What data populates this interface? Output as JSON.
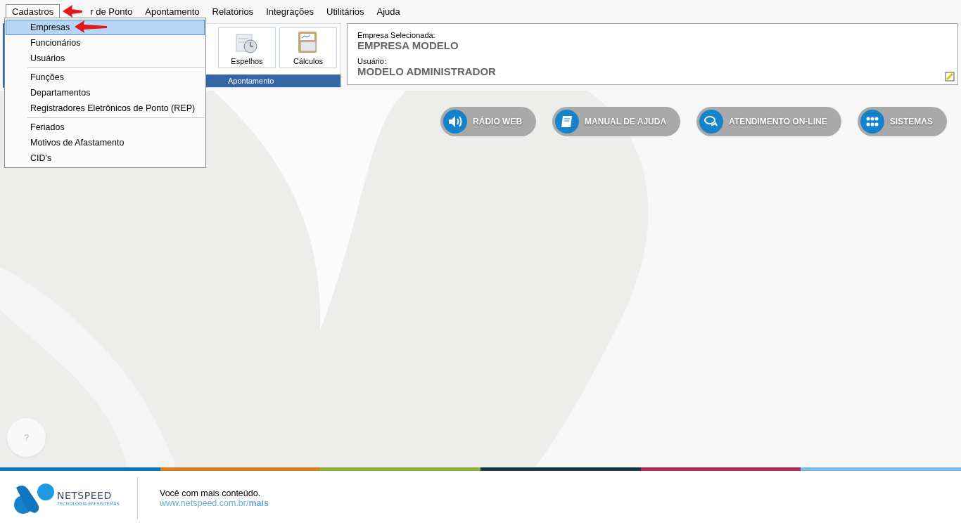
{
  "menu_bar": [
    {
      "label": "Cadastros",
      "selected": true
    },
    {
      "label": "r de Ponto",
      "selected": false
    },
    {
      "label": "Apontamento",
      "selected": false
    },
    {
      "label": "Relatórios",
      "selected": false
    },
    {
      "label": "Integrações",
      "selected": false
    },
    {
      "label": "Utilitários",
      "selected": false
    },
    {
      "label": "Ajuda",
      "selected": false
    }
  ],
  "dropdown": {
    "groups": [
      [
        {
          "label": "Empresas",
          "selected": true
        },
        {
          "label": "Funcionários",
          "selected": false
        },
        {
          "label": "Usuários",
          "selected": false
        }
      ],
      [
        {
          "label": "Funções",
          "selected": false
        },
        {
          "label": "Departamentos",
          "selected": false
        },
        {
          "label": "Registradores Eletrônicos de Ponto (REP)",
          "selected": false
        }
      ],
      [
        {
          "label": "Feriados",
          "selected": false
        },
        {
          "label": "Motivos de Afastamento",
          "selected": false
        },
        {
          "label": "CID's",
          "selected": false
        }
      ]
    ]
  },
  "ribbon": {
    "group_label": "Apontamento",
    "buttons": [
      {
        "label": "Espelhos",
        "kind": "clock"
      },
      {
        "label": "Cálculos",
        "kind": "calculator"
      }
    ]
  },
  "info_panel": {
    "company_label": "Empresa Selecionada:",
    "company": "EMPRESA MODELO",
    "user_label": "Usuário:",
    "user": "MODELO ADMINISTRADOR"
  },
  "quick_links": [
    {
      "label": "RÁDIO WEB",
      "kind": "speaker"
    },
    {
      "label": "MANUAL DE AJUDA",
      "kind": "book"
    },
    {
      "label": "ATENDIMENTO ON-LINE",
      "kind": "chat"
    },
    {
      "label": "SISTEMAS",
      "kind": "grid"
    }
  ],
  "help_button": "?",
  "stripe": [
    {
      "color": "#0f75bc"
    },
    {
      "color": "#d97d20"
    },
    {
      "color": "#8cb43c"
    },
    {
      "color": "#163a4a"
    },
    {
      "color": "#b22d4e"
    },
    {
      "color": "#7cbde9"
    }
  ],
  "footer": {
    "brand": "NETSPEED",
    "tagline": "TECNOLOGIA EM SISTEMAS",
    "slogan": "Você com mais conteúdo.",
    "link": "www.netspeed.com.br/**mais**"
  }
}
